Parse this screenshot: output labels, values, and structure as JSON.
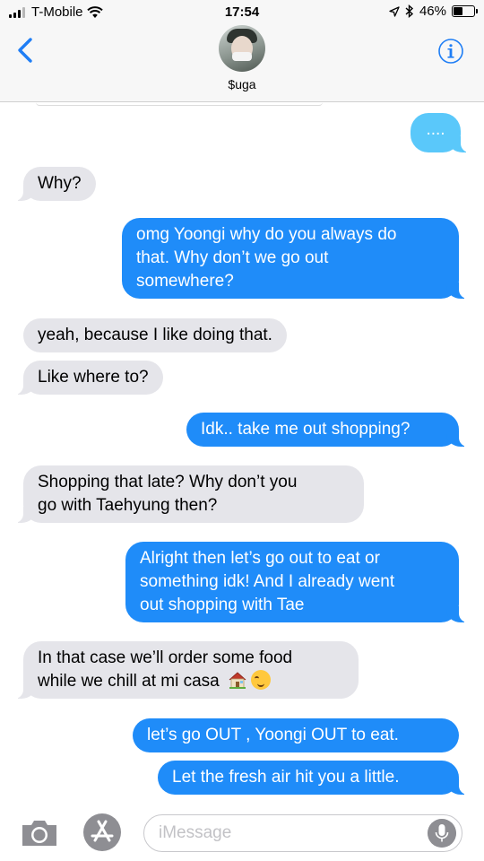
{
  "status_bar": {
    "carrier": "T-Mobile",
    "time": "17:54",
    "battery": "46%",
    "battery_level": 0.46
  },
  "header": {
    "contact_name": "$uga"
  },
  "messages": [
    {
      "id": 0,
      "from": "me",
      "text": "...."
    },
    {
      "id": 1,
      "from": "them",
      "text": "Why?"
    },
    {
      "id": 2,
      "from": "me",
      "lines": [
        "omg Yoongi why do you always do",
        "that. Why don’t we go out",
        "somewhere?"
      ]
    },
    {
      "id": 3,
      "from": "them",
      "text": "yeah, because I like doing that."
    },
    {
      "id": 4,
      "from": "them",
      "text": "Like where to?"
    },
    {
      "id": 5,
      "from": "me",
      "text": "Idk.. take me out shopping?"
    },
    {
      "id": 6,
      "from": "them",
      "lines": [
        "Shopping that late? Why don’t you",
        "go with Taehyung then?"
      ]
    },
    {
      "id": 7,
      "from": "me",
      "lines": [
        "Alright then let’s go out to eat or",
        "something idk! And I already went",
        "out shopping with Tae"
      ]
    },
    {
      "id": 8,
      "from": "them",
      "lines": [
        "In that case we’ll order some food",
        "while we chill at mi casa"
      ],
      "emoji": [
        "house-emoji",
        "relieved-face-emoji"
      ]
    },
    {
      "id": 9,
      "from": "me",
      "text": "let’s go OUT , Yoongi OUT to eat."
    },
    {
      "id": 10,
      "from": "me",
      "text": "Let the fresh air hit you a little."
    }
  ],
  "compose": {
    "placeholder": "iMessage",
    "value": ""
  },
  "colors": {
    "outgoing": "#1f8cf9",
    "outgoing_sending": "#5ac8fa",
    "incoming": "#e5e5ea",
    "accent": "#1f7ef5"
  },
  "icons": [
    "signal-icon",
    "wifi-icon",
    "location-arrow-icon",
    "bluetooth-icon",
    "battery-icon",
    "back-chevron-icon",
    "info-icon",
    "camera-icon",
    "app-store-icon",
    "microphone-icon"
  ]
}
